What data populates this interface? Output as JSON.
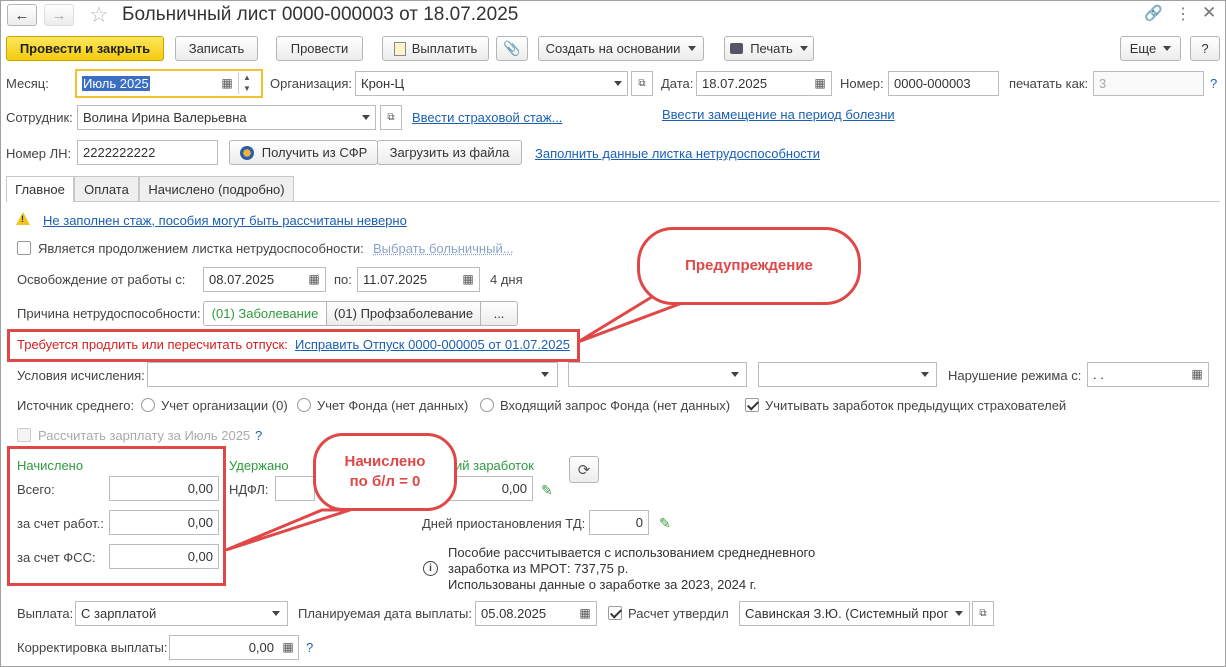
{
  "window": {
    "title": "Больничный лист 0000-000003 от 18.07.2025"
  },
  "toolbar": {
    "post_close": "Провести и закрыть",
    "save": "Записать",
    "post": "Провести",
    "pay": "Выплатить",
    "create_based": "Создать на основании",
    "print": "Печать",
    "more": "Еще",
    "help": "?"
  },
  "header": {
    "month_label": "Месяц:",
    "month_value": "Июль 2025",
    "org_label": "Организация:",
    "org_value": "Крон-Ц",
    "date_label": "Дата:",
    "date_value": "18.07.2025",
    "number_label": "Номер:",
    "number_value": "0000-000003",
    "print_as_label": "печатать как:",
    "print_as_value": "3",
    "help": "?",
    "employee_label": "Сотрудник:",
    "employee_value": "Волина Ирина Валерьевна",
    "insurance_link": "Ввести страховой стаж...",
    "replacement_link": "Ввести замещение на период болезни",
    "ln_label": "Номер ЛН:",
    "ln_value": "2222222222",
    "get_sfr": "Получить из СФР",
    "load_file": "Загрузить из файла",
    "fill_link": "Заполнить данные листка нетрудоспособности"
  },
  "tabs": [
    {
      "label": "Главное"
    },
    {
      "label": "Оплата"
    },
    {
      "label": "Начислено (подробно)"
    }
  ],
  "main": {
    "warning_link": "Не заполнен стаж, пособия могут быть рассчитаны неверно",
    "continuation_label": "Является продолжением листка нетрудоспособности:",
    "choose_sick_link": "Выбрать больничный...",
    "release_label": "Освобождение от работы с:",
    "release_from": "08.07.2025",
    "release_to_label": "по:",
    "release_to": "11.07.2025",
    "days": "4 дня",
    "reason_label": "Причина нетрудоспособности:",
    "reason_1": "(01) Заболевание",
    "reason_2": "(01) Профзаболевание",
    "reason_more": "...",
    "vacation_warning": "Требуется продлить или пересчитать отпуск:",
    "vacation_link": "Исправить Отпуск 0000-000005 от 01.07.2025",
    "conditions_label": "Условия исчисления:",
    "violation_label": "Нарушение режима с:",
    "violation_value": " .  .",
    "avg_source_label": "Источник среднего:",
    "radio_org": "Учет организации (0)",
    "radio_fund": "Учет Фонда (нет данных)",
    "radio_request": "Входящий запрос Фонда (нет данных)",
    "prev_insurers": "Учитывать заработок предыдущих страхователей",
    "calc_salary": "Рассчитать зарплату за Июль 2025",
    "help": "?"
  },
  "accrued": {
    "title": "Начислено",
    "total_label": "Всего:",
    "total_value": "0,00",
    "employer_label": "за счет работ.:",
    "employer_value": "0,00",
    "fss_label": "за счет ФСС:",
    "fss_value": "0,00"
  },
  "withheld": {
    "title": "Удержано",
    "ndfl_label": "НДФЛ:"
  },
  "avg_earnings": {
    "title_visible": "ий заработок",
    "value": "0,00",
    "suspension_label": "Дней приостановления ТД:",
    "suspension_value": "0",
    "info_line1": "Пособие рассчитывается с использованием среднедневного",
    "info_line2": "заработка из МРОТ: 737,75 р.",
    "info_line3": "Использованы данные о заработке за  2023,  2024 г."
  },
  "payment": {
    "label": "Выплата:",
    "value": "С зарплатой",
    "planned_label": "Планируемая дата выплаты:",
    "planned_value": "05.08.2025",
    "approved_label": "Расчет утвердил",
    "approved_value": "Савинская З.Ю. (Системный прог",
    "correction_label": "Корректировка выплаты:",
    "correction_value": "0,00",
    "help": "?"
  },
  "annotations": {
    "warning_callout": "Предупреждение",
    "accrued_callout_1": "Начислено",
    "accrued_callout_2": "по б/л  = 0"
  },
  "colors": {
    "accent_red": "#e04848",
    "link": "#1b5fb4",
    "primary": "#f3cb0f",
    "green": "#2e9b3e"
  }
}
